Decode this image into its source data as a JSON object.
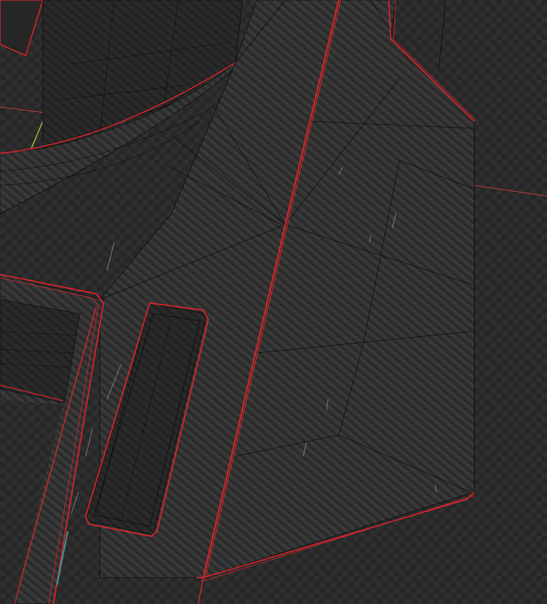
{
  "viewport": {
    "mode": "3d-edit-mesh",
    "background_checker": "#2f2f2f",
    "background_base": "#272727"
  },
  "colors": {
    "panel_fill": "#393939",
    "panel_texture": "#2a2a2a",
    "wire": "#0a0a0a",
    "seam": "#e0242a",
    "axis_x": "#c83c3c",
    "axis_y": "#9bc43c",
    "cut_fill": "#1e1e1e",
    "scratch": "#cfcfcf",
    "teal_mark": "#2e9e9e"
  }
}
